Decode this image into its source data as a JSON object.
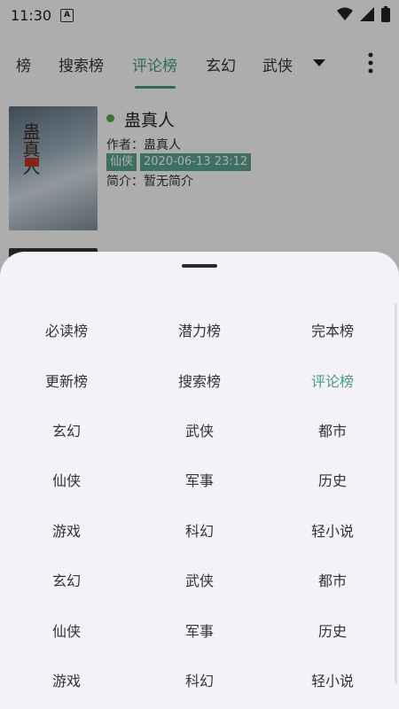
{
  "status": {
    "time": "11:30"
  },
  "tabs": [
    {
      "label": "榜"
    },
    {
      "label": "搜索榜"
    },
    {
      "label": "评论榜"
    },
    {
      "label": "玄幻"
    },
    {
      "label": "武侠"
    }
  ],
  "active_tab": "评论榜",
  "book": {
    "title": "蛊真人",
    "author": "作者：蛊真人",
    "tags": [
      "仙侠",
      "2020-06-13 23:12"
    ],
    "intro": "简介：暂无简介",
    "cover_text": "蛊真人"
  },
  "sheet": {
    "items": [
      {
        "label": "必读榜"
      },
      {
        "label": "潜力榜"
      },
      {
        "label": "完本榜"
      },
      {
        "label": "更新榜"
      },
      {
        "label": "搜索榜"
      },
      {
        "label": "评论榜"
      },
      {
        "label": "玄幻"
      },
      {
        "label": "武侠"
      },
      {
        "label": "都市"
      },
      {
        "label": "仙侠"
      },
      {
        "label": "军事"
      },
      {
        "label": "历史"
      },
      {
        "label": "游戏"
      },
      {
        "label": "科幻"
      },
      {
        "label": "轻小说"
      },
      {
        "label": "玄幻"
      },
      {
        "label": "武侠"
      },
      {
        "label": "都市"
      },
      {
        "label": "仙侠"
      },
      {
        "label": "军事"
      },
      {
        "label": "历史"
      },
      {
        "label": "游戏"
      },
      {
        "label": "科幻"
      },
      {
        "label": "轻小说"
      }
    ],
    "active_label": "评论榜"
  },
  "colors": {
    "accent": "#4a9a86",
    "tag_bg": "#5aa692",
    "sheet_bg": "#f5f1f8"
  }
}
